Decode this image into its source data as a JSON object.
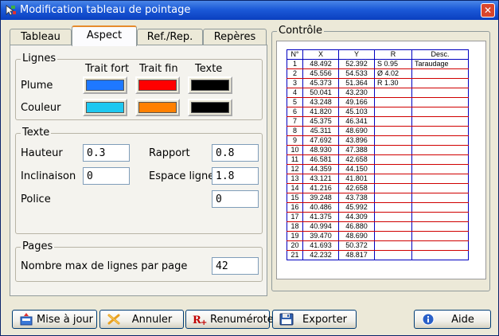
{
  "window": {
    "title": "Modification tableau de pointage"
  },
  "tabs": [
    {
      "label": "Tableau"
    },
    {
      "label": "Aspect"
    },
    {
      "label": "Ref./Rep."
    },
    {
      "label": "Repères"
    }
  ],
  "lignes": {
    "title": "Lignes",
    "columns": [
      "Trait fort",
      "Trait fin",
      "Texte"
    ],
    "plume_label": "Plume",
    "couleur_label": "Couleur",
    "colors": {
      "plume": [
        "#1e78ff",
        "#ff0000",
        "#000000"
      ],
      "couleur": [
        "#1ec8f0",
        "#ff8000",
        "#000000"
      ]
    }
  },
  "texte": {
    "title": "Texte",
    "hauteur_label": "Hauteur",
    "hauteur_value": "0.3",
    "rapport_label": "Rapport",
    "rapport_value": "0.8",
    "inclinaison_label": "Inclinaison",
    "inclinaison_value": "0",
    "espace_label": "Espace ligne",
    "espace_value": "1.8",
    "police_label": "Police",
    "police_value": "0"
  },
  "pages": {
    "title": "Pages",
    "max_label": "Nombre max de lignes par page",
    "max_value": "42"
  },
  "controle": {
    "title": "Contrôle",
    "headers": [
      "N°",
      "X",
      "Y",
      "R",
      "Desc."
    ],
    "rows": [
      [
        "1",
        "48.492",
        "52.392",
        "S  0.95",
        "Taraudage"
      ],
      [
        "2",
        "45.556",
        "54.533",
        "Ø  4.02",
        ""
      ],
      [
        "3",
        "45.373",
        "51.364",
        "R  1.30",
        ""
      ],
      [
        "4",
        "50.041",
        "43.230",
        "",
        ""
      ],
      [
        "5",
        "43.248",
        "49.166",
        "",
        ""
      ],
      [
        "6",
        "41.820",
        "45.103",
        "",
        ""
      ],
      [
        "7",
        "45.375",
        "46.341",
        "",
        ""
      ],
      [
        "8",
        "45.311",
        "48.690",
        "",
        ""
      ],
      [
        "9",
        "47.692",
        "43.896",
        "",
        ""
      ],
      [
        "10",
        "48.930",
        "47.388",
        "",
        ""
      ],
      [
        "11",
        "46.581",
        "42.658",
        "",
        ""
      ],
      [
        "12",
        "44.359",
        "44.150",
        "",
        ""
      ],
      [
        "13",
        "43.121",
        "41.801",
        "",
        ""
      ],
      [
        "14",
        "41.216",
        "42.658",
        "",
        ""
      ],
      [
        "15",
        "39.248",
        "43.738",
        "",
        ""
      ],
      [
        "16",
        "40.486",
        "45.992",
        "",
        ""
      ],
      [
        "17",
        "41.375",
        "44.309",
        "",
        ""
      ],
      [
        "18",
        "40.994",
        "46.880",
        "",
        ""
      ],
      [
        "19",
        "39.470",
        "48.690",
        "",
        ""
      ],
      [
        "20",
        "41.693",
        "50.372",
        "",
        ""
      ],
      [
        "21",
        "42.232",
        "48.817",
        "",
        ""
      ]
    ]
  },
  "buttons": {
    "update": "Mise à jour",
    "cancel": "Annuler",
    "renumber": "Renuméroter",
    "export": "Exporter",
    "help": "Aide"
  },
  "icons": {
    "title": "app-pointer-icon",
    "close": "close-icon",
    "update": "update-icon",
    "cancel": "cancel-icon",
    "renumber": "renumber-icon",
    "export": "floppy-disk-icon",
    "help": "info-icon"
  },
  "accent_colors": {
    "titlebar": "#0a3fbf",
    "active_tab": "#e68b2c",
    "close": "#d8452c"
  }
}
